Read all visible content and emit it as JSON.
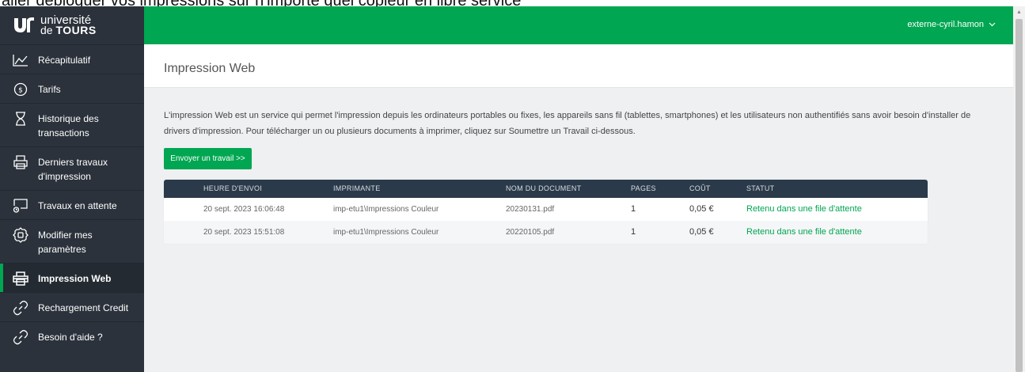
{
  "overlay_text": "aller débloquer vos impressions sur n'importe quel copieur en libre service",
  "logo": {
    "line1": "université",
    "line2_prefix": "de",
    "line2_bold": "TOURS"
  },
  "sidebar": {
    "items": [
      {
        "label": "Récapitulatif",
        "icon": "chart-line-icon"
      },
      {
        "label": "Tarifs",
        "icon": "dollar-circle-icon"
      },
      {
        "label": "Historique des transactions",
        "icon": "hourglass-icon"
      },
      {
        "label": "Derniers travaux d'impression",
        "icon": "printer-icon"
      },
      {
        "label": "Travaux en attente",
        "icon": "pending-print-icon"
      },
      {
        "label": "Modifier mes paramètres",
        "icon": "settings-icon"
      },
      {
        "label": "Impression Web",
        "icon": "web-print-icon",
        "active": true
      },
      {
        "label": "Rechargement Credit",
        "icon": "link-icon"
      },
      {
        "label": "Besoin d'aide ?",
        "icon": "link-icon"
      }
    ]
  },
  "topbar": {
    "username": "externe-cyril.hamon"
  },
  "page": {
    "title": "Impression Web",
    "description": "L'impression Web est un service qui permet l'impression depuis les ordinateurs portables ou fixes, les appareils sans fil (tablettes, smartphones) et les utilisateurs non authentifiés sans avoir besoin d'installer de drivers d'impression. Pour télécharger un ou plusieurs documents à imprimer, cliquez sur Soumettre un Travail ci-dessous.",
    "send_button": "Envoyer un travail >>"
  },
  "table": {
    "headers": [
      "Heure d'envoi",
      "Imprimante",
      "Nom du document",
      "Pages",
      "Coût",
      "Statut"
    ],
    "rows": [
      [
        "20 sept. 2023 16:06:48",
        "imp-etu1\\Impressions Couleur",
        "20230131.pdf",
        "1",
        "0,05 €",
        "Retenu dans une file d'attente"
      ],
      [
        "20 sept. 2023 15:51:08",
        "imp-etu1\\Impressions Couleur",
        "20220105.pdf",
        "1",
        "0,05 €",
        "Retenu dans une file d'attente"
      ]
    ]
  },
  "colors": {
    "accent": "#00a651",
    "sidebar": "#2b323b",
    "table_header": "#2b3a4a"
  }
}
